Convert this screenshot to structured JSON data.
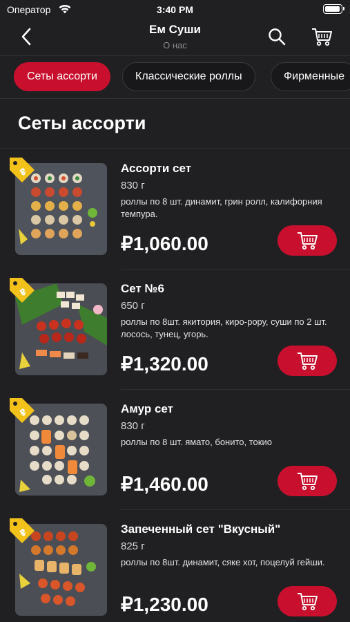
{
  "status_bar": {
    "carrier": "Оператор",
    "time": "3:40 PM"
  },
  "header": {
    "title": "Ем Суши",
    "subtitle": "О нас"
  },
  "tabs": [
    {
      "label": "Сеты ассорти",
      "active": true
    },
    {
      "label": "Классические роллы",
      "active": false
    },
    {
      "label": "Фирменные",
      "active": false
    }
  ],
  "section": {
    "title": "Сеты ассорти"
  },
  "products": [
    {
      "name": "Ассорти сет",
      "weight": "830 г",
      "description": "роллы по 8 шт. динамит, грин ролл, калифорния темпура.",
      "price": "₽1,060.00"
    },
    {
      "name": "Сет №6",
      "weight": "650 г",
      "description": "роллы по 8шт. якитория, киро-рору, суши по 2 шт. лосось, тунец, угорь.",
      "price": "₽1,320.00"
    },
    {
      "name": "Амур сет",
      "weight": "830 г",
      "description": "роллы по 8 шт. ямато, бонито, токио",
      "price": "₽1,460.00"
    },
    {
      "name": "Запеченный сет \"Вкусный\"",
      "weight": "825 г",
      "description": "роллы по 8шт. динамит, сяке хот, поцелуй гейши.",
      "price": "₽1,230.00"
    }
  ],
  "colors": {
    "accent": "#c8102e",
    "background": "#202022",
    "tag": "#f2c21b"
  },
  "icons": {
    "back": "chevron-left-icon",
    "search": "search-icon",
    "cart": "cart-icon",
    "tag": "discount-tag-icon",
    "add": "add-to-cart-icon"
  }
}
